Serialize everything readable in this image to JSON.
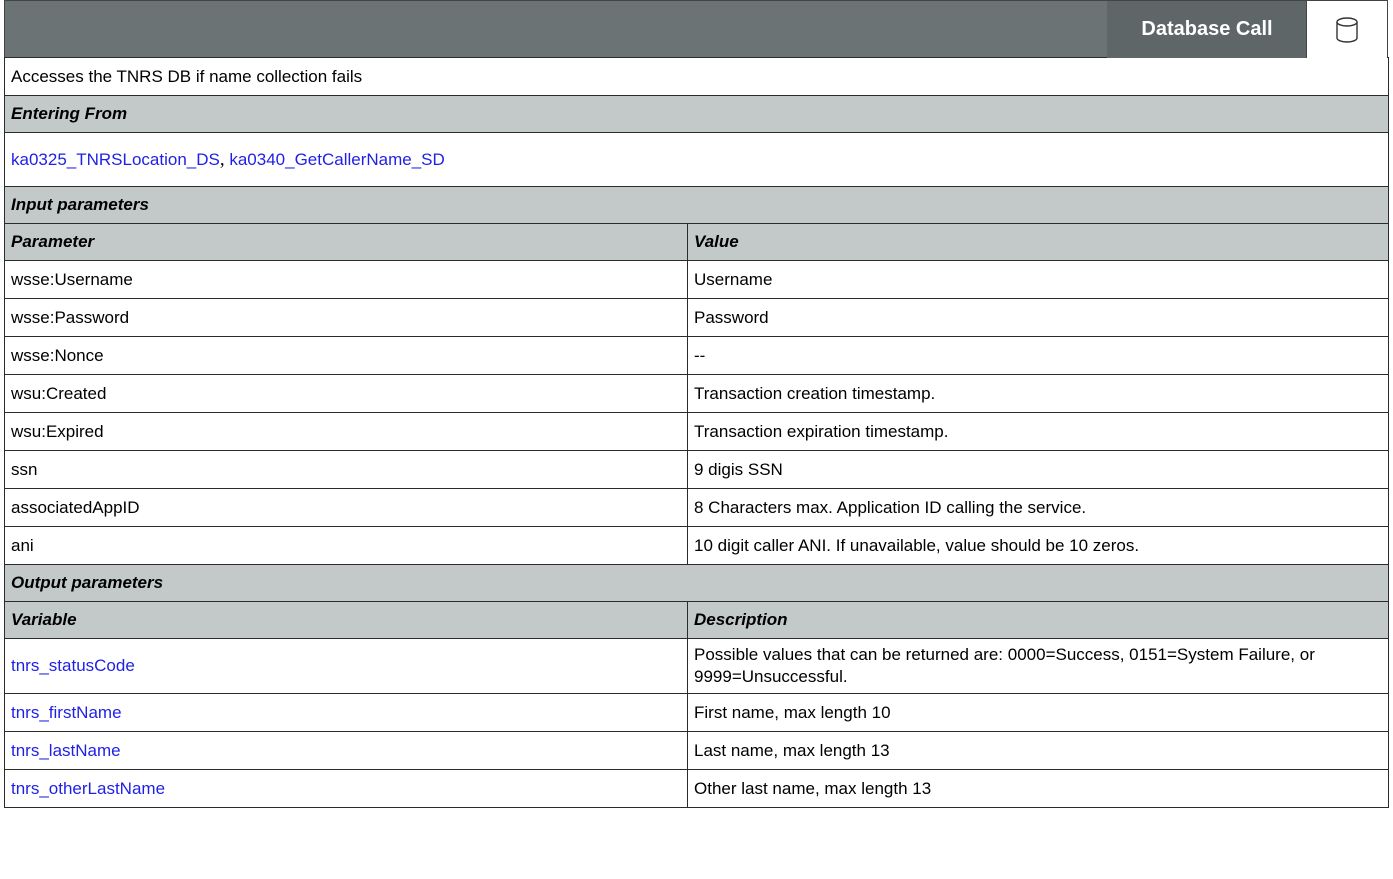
{
  "header": {
    "title": "Database Call",
    "icon": "database-icon"
  },
  "description": "Accesses the TNRS DB if name collection fails",
  "entering_from": {
    "heading": "Entering From",
    "links": [
      "ka0325_TNRSLocation_DS",
      "ka0340_GetCallerName_SD"
    ],
    "separator": ","
  },
  "input_parameters": {
    "heading": "Input parameters",
    "columns": [
      "Parameter",
      "Value"
    ],
    "rows": [
      {
        "param": "wsse:Username",
        "value": "Username"
      },
      {
        "param": "wsse:Password",
        "value": "Password"
      },
      {
        "param": "wsse:Nonce",
        "value": "--"
      },
      {
        "param": "wsu:Created",
        "value": "Transaction creation timestamp."
      },
      {
        "param": "wsu:Expired",
        "value": "Transaction expiration timestamp."
      },
      {
        "param": "ssn",
        "value": "9 digis SSN"
      },
      {
        "param": "associatedAppID",
        "value": "8 Characters max.  Application ID calling the service."
      },
      {
        "param": "ani",
        "value": "10 digit caller ANI. If unavailable, value should be 10 zeros."
      }
    ]
  },
  "output_parameters": {
    "heading": "Output parameters",
    "columns": [
      "Variable",
      "Description"
    ],
    "rows": [
      {
        "variable": "tnrs_statusCode",
        "description": "Possible values that can be returned are: 0000=Success, 0151=System Failure, or 9999=Unsuccessful."
      },
      {
        "variable": "tnrs_firstName",
        "description": "First name, max length 10"
      },
      {
        "variable": "tnrs_lastName",
        "description": "Last name, max length 13"
      },
      {
        "variable": "tnrs_otherLastName",
        "description": "Other last name, max length 13"
      }
    ]
  },
  "colors": {
    "header_bg": "#6b7374",
    "section_bg": "#c3c9c9",
    "link": "#1f1fe6"
  }
}
